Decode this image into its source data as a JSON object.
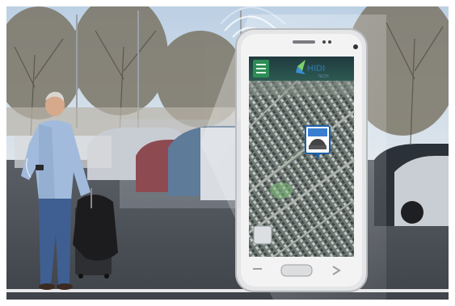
{
  "image": {
    "description_type": "photo-composite",
    "subject": "man-with-luggage-and-phone",
    "overlay": "smartphone-parking-app"
  },
  "phone": {
    "app_logo_text": "HIDI",
    "app_logo_subtext": "TECH",
    "map_type": "aerial-parking-lot",
    "menu_icon": "menu-icon",
    "car_pin_icon": "car-location-icon",
    "screen_header_color": "#2a8a5a",
    "screen_bezel_color": "#e8e8e8"
  },
  "colors": {
    "sky": "#c9d6e2",
    "asphalt": "#4a4f56",
    "shirt": "#9bb6da",
    "jeans": "#3c5a8a",
    "accent_green": "#3bb36a"
  }
}
